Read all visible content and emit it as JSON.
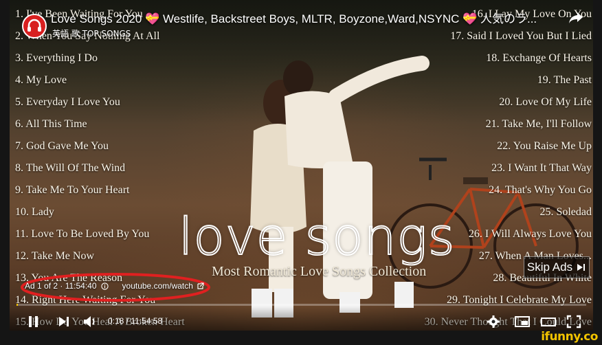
{
  "video": {
    "title": "Love Songs 2020 💝 Westlife, Backstreet Boys, MLTR, Boyzone,Ward,NSYNC 💝 人気のラ...",
    "channel_name": "英語 歌 TOP SONGS",
    "avatar_label": "TOP SONGS"
  },
  "tracklist_left": [
    "1. I've Been Waiting For You",
    "2. When You Say Nothing At All",
    "3. Everything I Do",
    "4. My Love",
    "5. Everyday I Love You",
    "6. All This Time",
    "7. God Gave Me You",
    "8. The Will Of The Wind",
    "9. Take Me To Your Heart",
    "10. Lady",
    "11. Love To Be Loved By You",
    "12. Take Me Now",
    "13. You Are The Reason",
    "14. Right Here Waiting For You",
    "15. How Do You Heal A Broken Heart"
  ],
  "tracklist_right": [
    "16. I Lay My Love On You",
    "17. Said I Loved You But I Lied",
    "18. Exchange Of Hearts",
    "19. The Past",
    "20. Love Of My Life",
    "21. Take Me, I'll Follow",
    "22. You Raise Me Up",
    "23. I Want It That Way",
    "24. That's Why You Go",
    "25. Soledad",
    "26. I Will Always Love You",
    "27. When A Man Loves...",
    "28. Beautiful In White",
    "29. Tonight I Celebrate My Love",
    "30. Never Thought That I Could Love"
  ],
  "artwork": {
    "logo_text": "love songs",
    "subtitle": "Most Romantic Love Songs Collection"
  },
  "ad": {
    "counter": "Ad 1 of 2 · 11:54:40",
    "link": "youtube.com/watch",
    "skip_label": "Skip Ads"
  },
  "player": {
    "current_time": "0:18",
    "duration": "11:54:58",
    "time_display": "0:18 / 11:54:58",
    "progress_fraction": 0.0004
  },
  "watermark": "ifunny.co",
  "colors": {
    "progress": "#f5c400",
    "ad_highlight": "#e02020",
    "watermark": "#f2c400",
    "avatar": "#d82020"
  },
  "icons": {
    "share": "share-icon",
    "play": "play-icon",
    "next": "next-icon",
    "volume": "volume-icon",
    "settings": "gear-icon",
    "miniplayer": "miniplayer-icon",
    "theater": "theater-icon",
    "fullscreen": "fullscreen-icon",
    "info": "info-icon",
    "external": "external-link-icon"
  }
}
